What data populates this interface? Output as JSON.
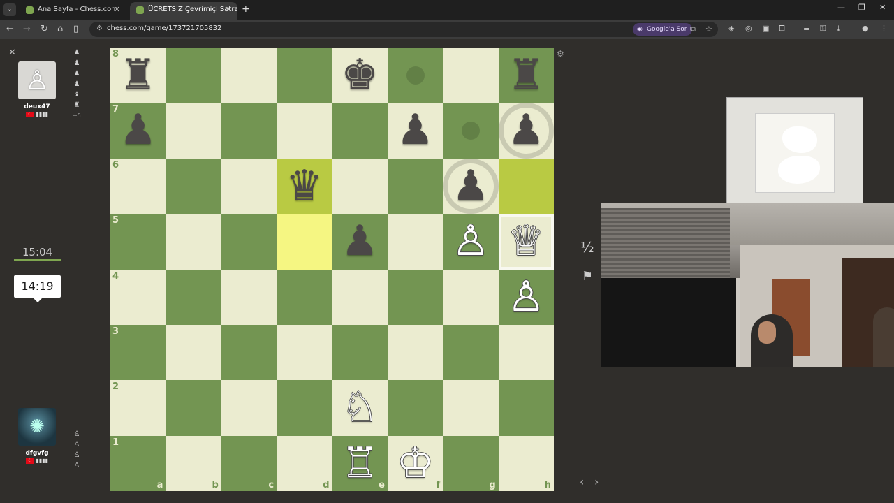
{
  "browser": {
    "tabs": [
      {
        "title": "Ana Sayfa - Chess.com",
        "active": false
      },
      {
        "title": "ÜCRETSİZ Çevrimiçi Satranç Oy",
        "active": true
      }
    ],
    "url": "chess.com/game/173721705832",
    "google_lens_label": "Google'a Sor"
  },
  "players": {
    "top": {
      "name": "deux47",
      "clock": "15:04",
      "captured": [
        "♟",
        "♟",
        "♟",
        "♟",
        "♝",
        "♜"
      ],
      "material": "+5"
    },
    "bottom": {
      "name": "dfgvfg",
      "clock": "14:19",
      "captured": [
        "♙",
        "♙",
        "♙",
        "♙",
        "♙"
      ]
    }
  },
  "board": {
    "orientation": "white",
    "ranks": [
      "8",
      "7",
      "6",
      "5",
      "4",
      "3",
      "2",
      "1"
    ],
    "files": [
      "a",
      "b",
      "c",
      "d",
      "e",
      "f",
      "g",
      "h"
    ],
    "pieces": [
      {
        "square": "a8",
        "glyph": "♜",
        "color": "b"
      },
      {
        "square": "e8",
        "glyph": "♚",
        "color": "b"
      },
      {
        "square": "h8",
        "glyph": "♜",
        "color": "b"
      },
      {
        "square": "a7",
        "glyph": "♟",
        "color": "b"
      },
      {
        "square": "f7",
        "glyph": "♟",
        "color": "b"
      },
      {
        "square": "h7",
        "glyph": "♟",
        "color": "b"
      },
      {
        "square": "d6",
        "glyph": "♛",
        "color": "b"
      },
      {
        "square": "g6",
        "glyph": "♟",
        "color": "b"
      },
      {
        "square": "e5",
        "glyph": "♟",
        "color": "b"
      },
      {
        "square": "g5",
        "glyph": "♙",
        "color": "w"
      },
      {
        "square": "h5",
        "glyph": "♕",
        "color": "w"
      },
      {
        "square": "h4",
        "glyph": "♙",
        "color": "w"
      },
      {
        "square": "e2",
        "glyph": "♘",
        "color": "w"
      },
      {
        "square": "e1",
        "glyph": "♖",
        "color": "w"
      },
      {
        "square": "f1",
        "glyph": "♔",
        "color": "w"
      }
    ],
    "highlighted_squares": [
      "d6",
      "d5",
      "h6"
    ],
    "move_dots": [
      "f8",
      "g7"
    ],
    "capture_rings": [
      "h7",
      "g6"
    ],
    "hover_square": "h5"
  },
  "controls": {
    "draw_label": "½",
    "resign_icon": "flag-icon"
  },
  "colors": {
    "light_square": "#ebecd0",
    "dark_square": "#739552",
    "highlight_light": "#f5f682",
    "highlight_dark": "#b9ca43",
    "background": "#302e2b"
  }
}
